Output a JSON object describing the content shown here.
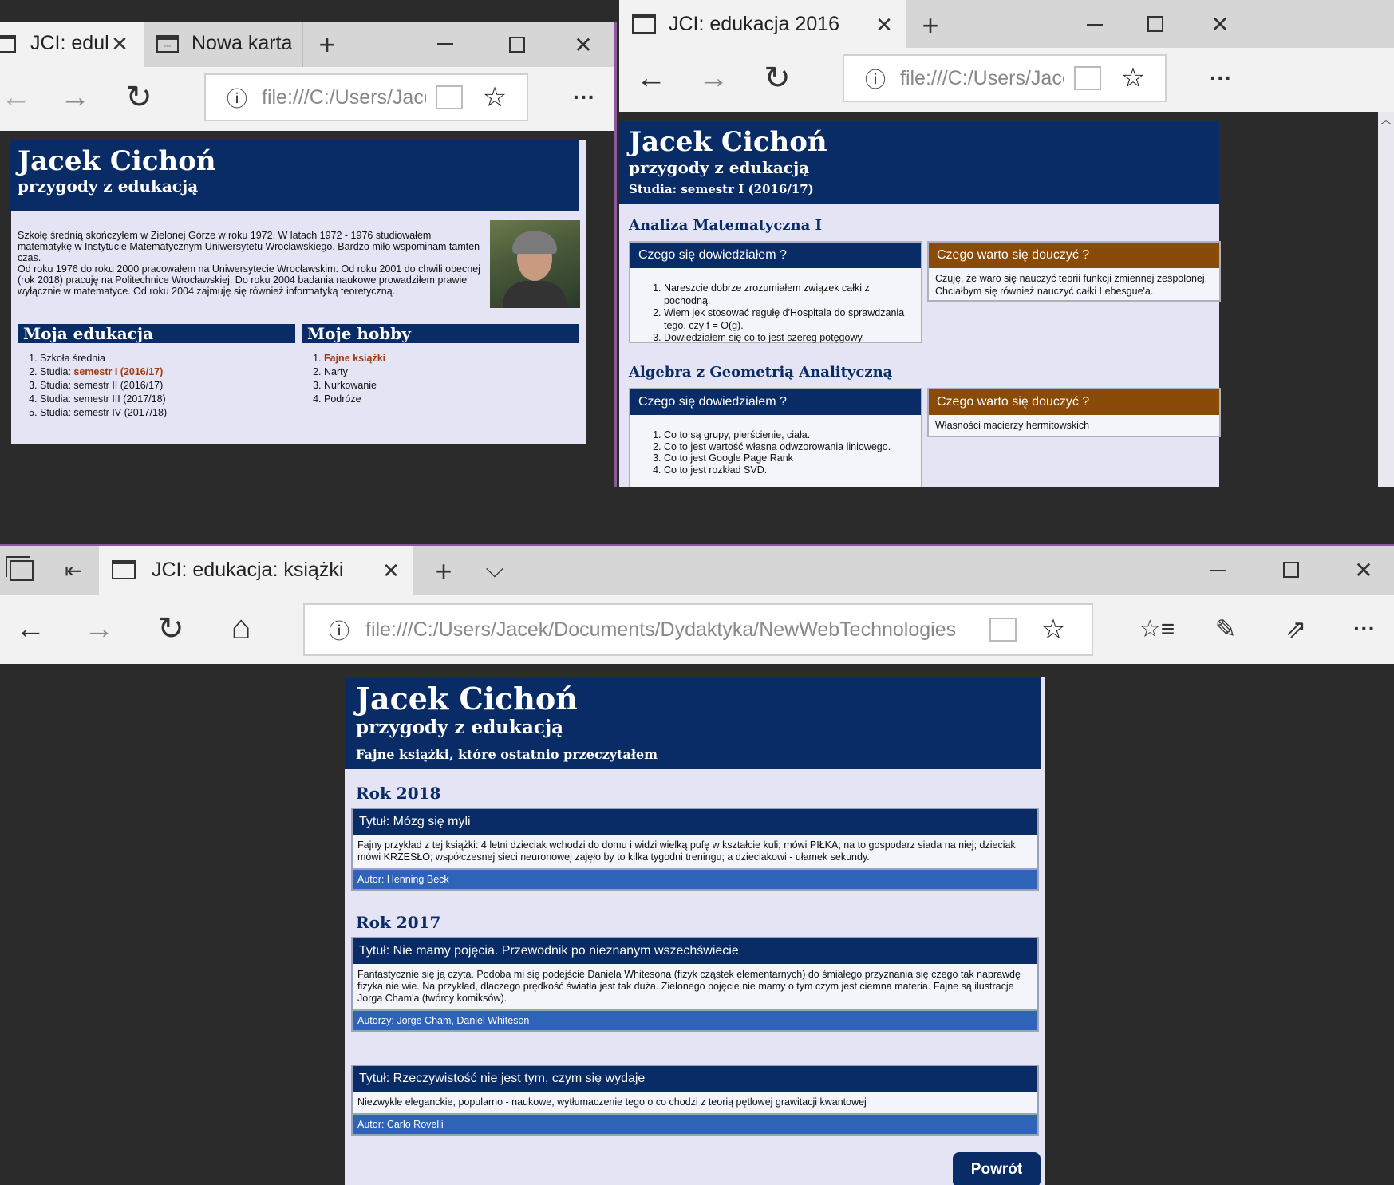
{
  "win1": {
    "tab1_title": "JCI: edul",
    "tab2_title": "Nowa karta",
    "url": "file:///C:/Users/Jacel",
    "page": {
      "name": "Jacek Cichoń",
      "subtitle": "przygody z edukacją",
      "para1": "Szkołę średnią skończyłem w Zielonej Górze w roku 1972. W latach 1972 - 1976 studiowałem matematykę w Instytucie Matematycznym Uniwersytetu Wrocławskiego. Bardzo miło wspominam tamten czas.",
      "para2": "Od roku 1976 do roku 2000 pracowałem na Uniwersytecie Wrocławskim. Od roku 2001 do chwili obecnej (rok 2018) pracuję na Politechnice Wrocławskiej. Do roku 2004 badania naukowe prowadziłem prawie wyłącznie w matematyce. Od roku 2004 zajmuję się również informatyką teoretyczną.",
      "edu_heading": "Moja edukacja",
      "hobby_heading": "Moje hobby",
      "edu_items": [
        "Szkoła średnia",
        "Studia: ",
        "Studia: semestr II (2016/17)",
        "Studia: semestr III (2017/18)",
        "Studia: semestr IV (2017/18)"
      ],
      "edu_link": "semestr I (2016/17)",
      "hobby_items": [
        "Fajne książki",
        "Narty",
        "Nurkowanie",
        "Podróże"
      ]
    }
  },
  "win2": {
    "tab_title": "JCI: edukacja 2016",
    "url": "file:///C:/Users/Jacel",
    "page": {
      "name": "Jacek Cichoń",
      "subtitle": "przygody z edukacją",
      "line3": "Studia: semestr I (2016/17)",
      "course1": "Analiza Matematyczna I",
      "course2": "Algebra z Geometrią Analityczną",
      "learned_h": "Czego się dowiedziałem ?",
      "tolearn_h": "Czego warto się douczyć ?",
      "c1_learned": [
        "Nareszcie dobrze zrozumiałem związek całki z pochodną.",
        "Wiem jek stosować regułę d'Hospitala do sprawdzania tego, czy f = O(g).",
        "Dowiedziałem się co to jest szereg potęgowy."
      ],
      "c1_tolearn": "Czuję, że waro się nauczyć teorii funkcji zmiennej zespolonej. Chciałbym się również nauczyć całki Lebesgue'a.",
      "c2_learned": [
        "Co to są grupy, pierścienie, ciała.",
        "Co to jest wartość własna odwzorowania liniowego.",
        "Co to jest Google Page Rank",
        "Co to jest rozkład SVD."
      ],
      "c2_tolearn": "Własności macierzy hermitowskich"
    }
  },
  "win3": {
    "tab_title": "JCI: edukacja: książki",
    "url": "file:///C:/Users/Jacek/Documents/Dydaktyka/NewWebTechnologies",
    "page": {
      "name": "Jacek Cichoń",
      "subtitle": "przygody z edukacją",
      "line3": "Fajne książki, które ostatnio przeczytałem",
      "year1": "Rok 2018",
      "year2": "Rok 2017",
      "books": [
        {
          "title": "Tytuł: Mózg się myli",
          "desc": "Fajny przykład z tej książki: 4 letni dzieciak wchodzi do domu i widzi wielką pufę w kształcie kuli; mówi PIŁKA; na to gospodarz siada na niej; dzieciak mówi KRZESŁO; współczesnej sieci neuronowej zajęło by to kilka tygodni treningu; a dzieciakowi - ułamek sekundy.",
          "author": "Autor: Henning Beck"
        },
        {
          "title": "Tytuł: Nie mamy pojęcia. Przewodnik po nieznanym wszechświecie",
          "desc": "Fantastycznie się ją czyta. Podoba mi się podejście Daniela Whitesona (fizyk cząstek elementarnych) do śmiałego przyznania się czego tak naprawdę fizyka nie wie. Na przykład, dlaczego prędkość światła jest tak duża. Zielonego pojęcie nie mamy o tym czym jest ciemna materia. Fajne są ilustracje Jorga Cham'a (twórcy komiksów).",
          "author": "Autorzy: Jorge Cham, Daniel Whiteson"
        },
        {
          "title": "Tytuł: Rzeczywistość nie jest tym, czym się wydaje",
          "desc": "Niezwykle eleganckie, popularno - naukowe, wytłumaczenie tego o co chodzi z teorią pętlowej grawitacji kwantowej",
          "author": "Autor: Carlo Rovelli"
        }
      ],
      "back_label": "Powrót"
    }
  },
  "icons": {
    "close": "✕",
    "plus": "+",
    "minimize": "—",
    "maximize": "☐",
    "more": "···",
    "back": "←",
    "forward": "→",
    "refresh": "↻",
    "home": "⌂",
    "info": "ⓘ",
    "star": "☆",
    "chevron": "⌵"
  }
}
